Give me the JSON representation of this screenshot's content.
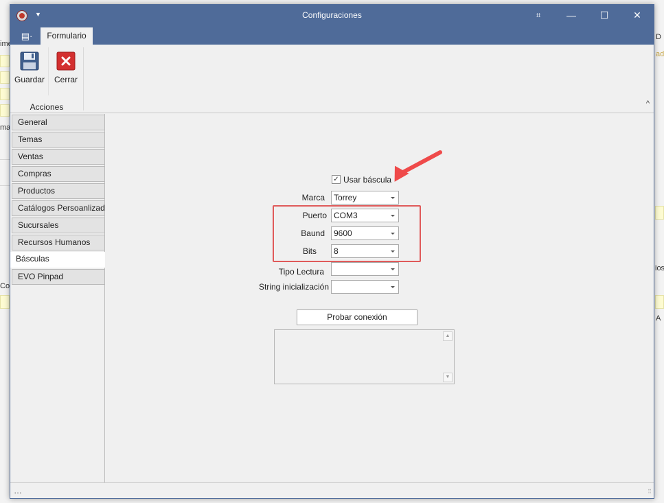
{
  "window": {
    "title": "Configuraciones",
    "min_label": "—",
    "max_label": "☐",
    "close_label": "✕",
    "restore_label": "⌗"
  },
  "ribbon": {
    "file_menu_label": "▤·",
    "tab_label": "Formulario",
    "group_label": "Acciones",
    "save_label": "Guardar",
    "close_label": "Cerrar",
    "collapse_label": "^"
  },
  "sidebar": {
    "items": [
      {
        "label": "General"
      },
      {
        "label": "Temas"
      },
      {
        "label": "Ventas"
      },
      {
        "label": "Compras"
      },
      {
        "label": "Productos"
      },
      {
        "label": "Catálogos Persoanlizados"
      },
      {
        "label": "Sucursales"
      },
      {
        "label": "Recursos Humanos"
      },
      {
        "label": "Básculas"
      },
      {
        "label": "EVO Pinpad"
      }
    ],
    "active_index": 8
  },
  "form": {
    "use_scale_label": "Usar báscula",
    "use_scale_checked": true,
    "brand_label": "Marca",
    "brand_value": "Torrey",
    "port_label": "Puerto",
    "port_value": "COM3",
    "baud_label": "Baund",
    "baud_value": "9600",
    "bits_label": "Bits",
    "bits_value": "8",
    "read_type_label": "Tipo Lectura",
    "read_type_value": "",
    "init_string_label": "String inicialización",
    "init_string_value": "",
    "test_button_label": "Probar conexión",
    "log_text": ""
  },
  "statusbar": {
    "text": "…"
  },
  "background_fragments": {
    "t1": "ime",
    "t2": "mac",
    "t3": "Cor",
    "t4": "D",
    "t5": "ad",
    "t6": "ios",
    "t7": "A"
  },
  "colors": {
    "titlebar": "#4f6b99",
    "highlight_box": "#e05a5a",
    "annotation_arrow": "#ef4a4a"
  }
}
